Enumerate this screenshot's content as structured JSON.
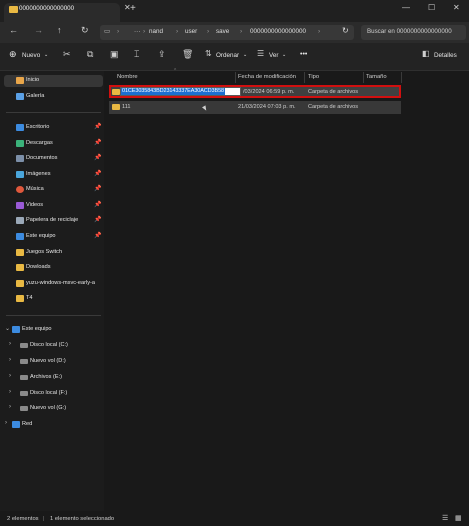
{
  "tab": {
    "title": "0000000000000000"
  },
  "window": {
    "minimize": "—",
    "maximize": "☐",
    "close": "✕"
  },
  "breadcrumbs": [
    "nand",
    "user",
    "save",
    "0000000000000000"
  ],
  "search": {
    "placeholder": "Buscar en 0000000000000000"
  },
  "toolbar": {
    "new_label": "Nuevo",
    "sort_label": "Ordenar",
    "view_label": "Ver",
    "more_label": "•••",
    "details_label": "Detalles"
  },
  "sidebar": {
    "top": [
      {
        "label": "Inicio",
        "icon": "home-icon",
        "color": "#e9a64a",
        "selected": true
      },
      {
        "label": "Galería",
        "icon": "gallery-icon",
        "color": "#5aa0e6"
      }
    ],
    "quick": [
      {
        "label": "Escritorio",
        "icon": "desktop-icon",
        "color": "#3c8be0",
        "pinned": true
      },
      {
        "label": "Descargas",
        "icon": "download-icon",
        "color": "#3bb27a",
        "pinned": true
      },
      {
        "label": "Documentos",
        "icon": "documents-icon",
        "color": "#7c8fa8",
        "pinned": true
      },
      {
        "label": "Imágenes",
        "icon": "pictures-icon",
        "color": "#4aa6dc",
        "pinned": true
      },
      {
        "label": "Música",
        "icon": "music-icon",
        "color": "#e0583c",
        "pinned": true
      },
      {
        "label": "Videos",
        "icon": "videos-icon",
        "color": "#9a5ad6",
        "pinned": true
      },
      {
        "label": "Papelera de reciclaje",
        "icon": "recycle-bin-icon",
        "color": "#9aa8b8",
        "pinned": true
      },
      {
        "label": "Este equipo",
        "icon": "computer-icon",
        "color": "#3c8be0",
        "pinned": true
      },
      {
        "label": "Juegos Switch",
        "icon": "folder-icon",
        "color": "#e9b943"
      },
      {
        "label": "Dowloads",
        "icon": "folder-icon",
        "color": "#e9b943"
      },
      {
        "label": "yuzu-windows-msvc-early-a",
        "icon": "folder-icon",
        "color": "#e9b943"
      },
      {
        "label": "T4",
        "icon": "folder-icon",
        "color": "#e9b943"
      }
    ],
    "tree": [
      {
        "label": "Este equipo",
        "icon": "computer-icon",
        "color": "#3c8be0",
        "expanded": true
      },
      {
        "label": "Disco local (C:)",
        "icon": "drive-icon",
        "color": "#8a8a8a"
      },
      {
        "label": "Nuevo vol (D:)",
        "icon": "drive-icon",
        "color": "#8a8a8a"
      },
      {
        "label": "Archivos (E:)",
        "icon": "drive-icon",
        "color": "#8a8a8a"
      },
      {
        "label": "Disco local (F:)",
        "icon": "drive-icon",
        "color": "#8a8a8a"
      },
      {
        "label": "Nuevo vol (G:)",
        "icon": "drive-icon",
        "color": "#8a8a8a"
      },
      {
        "label": "Red",
        "icon": "network-icon",
        "color": "#3c8be0"
      }
    ]
  },
  "columns": [
    "Nombre",
    "Fecha de modificación",
    "Tipo",
    "Tamaño"
  ],
  "rows": [
    {
      "name": "01CE3035843BD23143337EA30ACD3B58",
      "date": "21/03/2024 06:59 p. m.",
      "date_visible": "/03/2024 06:59 p. m.",
      "type": "Carpeta de archivos",
      "renaming": true
    },
    {
      "name": "111",
      "date": "21/03/2024 07:03 p. m.",
      "type": "Carpeta de archivos"
    }
  ],
  "status": {
    "count": "2 elementos",
    "selected": "1 elemento seleccionado"
  },
  "colors": {
    "accent": "#1c6fd1",
    "highlight_border": "#d10f0f",
    "folder": "#e9b943"
  }
}
